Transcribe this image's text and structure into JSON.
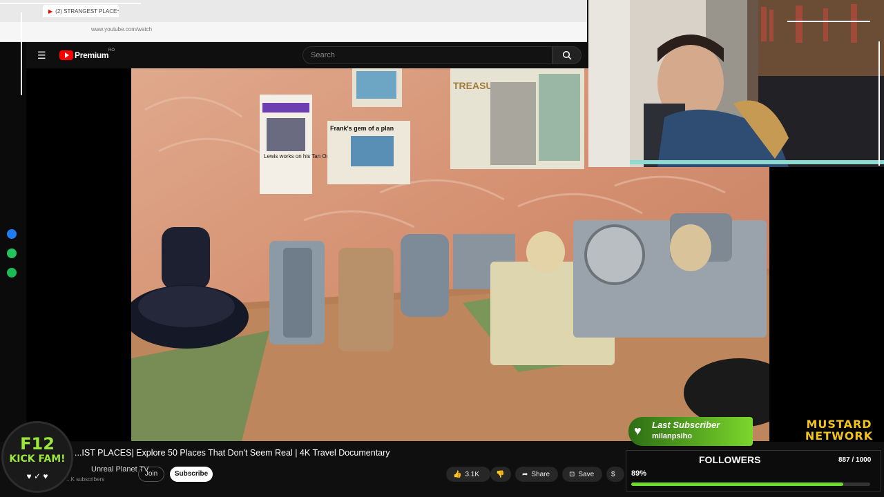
{
  "browser": {
    "tab_title": "(2) STRANGEST PLACE",
    "new_tab": "+",
    "url": "www.youtube.com/watch"
  },
  "youtube": {
    "logo_text": "Premium",
    "logo_region": "RO",
    "search_placeholder": "Search",
    "video_title": "...IST PLACES| Explore 50 Places That Don't Seem Real | 4K Travel Documentary",
    "channel_name": "Unreal Planet TV",
    "subscriber_count": "...K subscribers",
    "join_label": "Join",
    "subscribe_label": "Subscribe",
    "like_count": "3.1K",
    "share_label": "Share",
    "save_label": "Save"
  },
  "overlay": {
    "badge_line1": "F12",
    "badge_line2": "KICK FAM!",
    "last_subscriber_title": "Last Subscriber",
    "last_subscriber_name": "milanpsiho",
    "network_line1": "MUSTARD",
    "network_line2": "NETWORK",
    "followers_title": "FOLLOWERS",
    "followers_count": "887 / 1000",
    "followers_percent_label": "89%",
    "followers_progress": 0.887
  },
  "video_scene": {
    "clipping1_headline": "Lewis works on his Tan Outback",
    "clipping2_headline": "Frank's gem of a plan",
    "poster_text": "TREASURE HUNT"
  },
  "colors": {
    "accent_green": "#6cdb2d",
    "youtube_red": "#ff0000",
    "mustard": "#f2c419"
  }
}
